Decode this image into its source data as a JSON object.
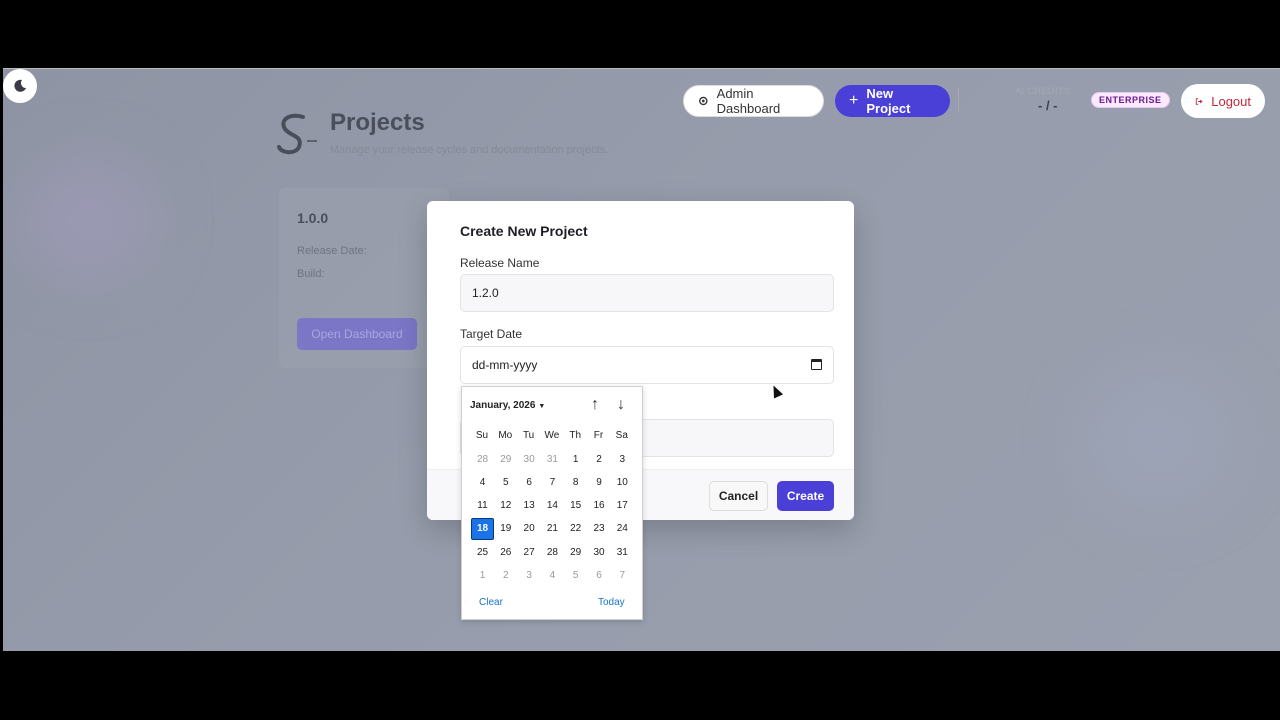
{
  "header": {
    "admin_label": "Admin Dashboard",
    "new_project_label": "New Project",
    "timer_label": "AI CREDITS",
    "timer_value": "- / -",
    "plan_badge": "ENTERPRISE",
    "logout_label": "Logout"
  },
  "page": {
    "title": "Projects",
    "subtitle": "Manage your release cycles and documentation projects."
  },
  "project_card": {
    "version": "1.0.0",
    "release_date_label": "Release Date:",
    "build_label": "Build:",
    "open_label": "Open Dashboard"
  },
  "modal": {
    "title": "Create New Project",
    "release_name_label": "Release Name",
    "release_name_value": "1.2.0",
    "target_date_label": "Target Date",
    "target_date_placeholder": "dd-mm-yyyy",
    "cancel_label": "Cancel",
    "create_label": "Create"
  },
  "date_picker": {
    "month": "January, 2026",
    "weekdays": [
      "Su",
      "Mo",
      "Tu",
      "We",
      "Th",
      "Fr",
      "Sa"
    ],
    "weeks": [
      [
        {
          "d": "28",
          "m": true
        },
        {
          "d": "29",
          "m": true
        },
        {
          "d": "30",
          "m": true
        },
        {
          "d": "31",
          "m": true
        },
        {
          "d": "1"
        },
        {
          "d": "2"
        },
        {
          "d": "3"
        }
      ],
      [
        {
          "d": "4"
        },
        {
          "d": "5"
        },
        {
          "d": "6"
        },
        {
          "d": "7"
        },
        {
          "d": "8"
        },
        {
          "d": "9"
        },
        {
          "d": "10"
        }
      ],
      [
        {
          "d": "11"
        },
        {
          "d": "12"
        },
        {
          "d": "13"
        },
        {
          "d": "14"
        },
        {
          "d": "15"
        },
        {
          "d": "16"
        },
        {
          "d": "17"
        }
      ],
      [
        {
          "d": "18",
          "sel": true
        },
        {
          "d": "19"
        },
        {
          "d": "20"
        },
        {
          "d": "21"
        },
        {
          "d": "22"
        },
        {
          "d": "23"
        },
        {
          "d": "24"
        }
      ],
      [
        {
          "d": "25"
        },
        {
          "d": "26"
        },
        {
          "d": "27"
        },
        {
          "d": "28"
        },
        {
          "d": "29"
        },
        {
          "d": "30"
        },
        {
          "d": "31"
        }
      ],
      [
        {
          "d": "1",
          "m": true
        },
        {
          "d": "2",
          "m": true
        },
        {
          "d": "3",
          "m": true
        },
        {
          "d": "4",
          "m": true
        },
        {
          "d": "5",
          "m": true
        },
        {
          "d": "6",
          "m": true
        },
        {
          "d": "7",
          "m": true
        }
      ]
    ],
    "clear_label": "Clear",
    "today_label": "Today"
  },
  "colors": {
    "accent": "#4a3fd6",
    "selected_day": "#1a73e8",
    "logout": "#c0283a"
  }
}
